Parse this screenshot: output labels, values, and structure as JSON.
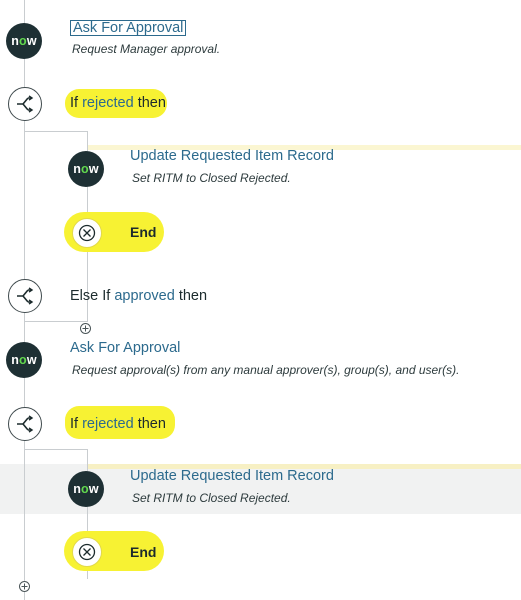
{
  "flow": {
    "step1": {
      "title": "Ask For Approval",
      "description": "Request Manager approval."
    },
    "cond1": {
      "prefix": "If",
      "keyword": "rejected",
      "suffix": "then"
    },
    "step2": {
      "title": "Update Requested Item Record",
      "description": "Set RITM to Closed Rejected."
    },
    "end1": {
      "label": "End"
    },
    "cond2": {
      "prefix": "Else If",
      "keyword": "approved",
      "suffix": "then"
    },
    "step3": {
      "title": "Ask For Approval",
      "description": "Request approval(s) from any manual approver(s), group(s), and user(s)."
    },
    "cond3": {
      "prefix": "If",
      "keyword": "rejected",
      "suffix": "then"
    },
    "step4": {
      "title": "Update Requested Item Record",
      "description": "Set RITM to Closed Rejected."
    },
    "end2": {
      "label": "End"
    },
    "logo_text": "now",
    "icons": [
      "servicenow-logo-icon",
      "branch-icon",
      "end-x-icon",
      "add-icon"
    ],
    "colors": {
      "highlight": "#f7f233",
      "link": "#2c6a8d",
      "logo_bg": "#1e3034",
      "logo_accent": "#62d84e"
    }
  }
}
